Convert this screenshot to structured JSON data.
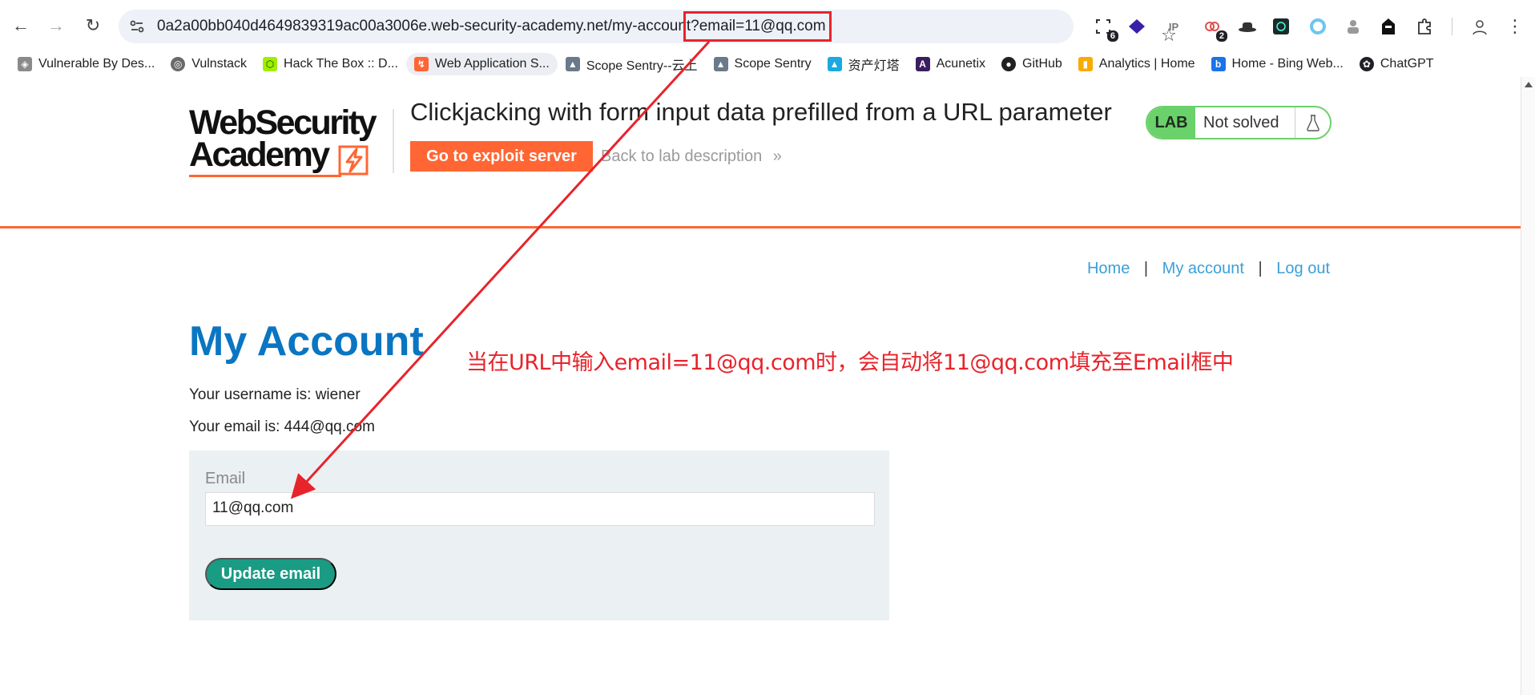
{
  "browser": {
    "url": "0a2a00bb040d4649839319ac00a3006e.web-security-academy.net/my-account?email=11@qq.com",
    "extensions": [
      {
        "name": "screenshot-ext",
        "badge": "6"
      },
      {
        "name": "stack-ext",
        "badge": ""
      },
      {
        "name": "ip-ext",
        "badge": ""
      },
      {
        "name": "link-ext",
        "badge": "2"
      },
      {
        "name": "hat-ext",
        "badge": ""
      },
      {
        "name": "terminal-ext",
        "badge": ""
      },
      {
        "name": "circle-ext",
        "badge": ""
      },
      {
        "name": "spy-ext",
        "badge": ""
      },
      {
        "name": "hacker-ext",
        "badge": ""
      }
    ]
  },
  "bookmarks": [
    {
      "label": "Vulnerable By Des...",
      "icon": "cube-icon",
      "color": "#8a8a8a"
    },
    {
      "label": "Vulnstack",
      "icon": "globe-icon",
      "color": "#6a6a6a"
    },
    {
      "label": "Hack The Box :: D...",
      "icon": "htb-icon",
      "color": "#9fef00"
    },
    {
      "label": "Web Application S...",
      "icon": "portswigger-icon",
      "color": "#ff6633"
    },
    {
      "label": "Scope Sentry--云上",
      "icon": "sentry-icon",
      "color": "#6a7a8a"
    },
    {
      "label": "Scope Sentry",
      "icon": "sentry-icon",
      "color": "#6a7a8a"
    },
    {
      "label": "资产灯塔",
      "icon": "lighthouse-icon",
      "color": "#1aa9e0"
    },
    {
      "label": "Acunetix",
      "icon": "acunetix-icon",
      "color": "#3a1f5f"
    },
    {
      "label": "GitHub",
      "icon": "github-icon",
      "color": "#202124"
    },
    {
      "label": "Analytics | Home",
      "icon": "analytics-icon",
      "color": "#f9ab00"
    },
    {
      "label": "Home - Bing Web...",
      "icon": "bing-icon",
      "color": "#1a73e8"
    },
    {
      "label": "ChatGPT",
      "icon": "chatgpt-icon",
      "color": "#202124"
    }
  ],
  "header": {
    "logo_line1": "WebSecurity",
    "logo_line2": "Academy",
    "lab_title": "Clickjacking with form input data prefilled from a URL parameter",
    "exploit_button": "Go to exploit server",
    "back_link": "Back to lab description",
    "back_chevron": "»",
    "lab_tag": "LAB",
    "lab_status": "Not solved"
  },
  "nav": {
    "home": "Home",
    "my_account": "My account",
    "log_out": "Log out",
    "separator": "|"
  },
  "account": {
    "title": "My Account",
    "username_line": "Your username is: wiener",
    "email_line": "Your email is: 444@qq.com",
    "email_label": "Email",
    "email_value": "11@qq.com",
    "update_button": "Update email"
  },
  "annotation": {
    "text": "当在URL中输入email=11@qq.com时，会自动将11@qq.com填充至Email框中",
    "color": "#e8232b"
  },
  "colors": {
    "accent_orange": "#ff6633",
    "link_blue": "#3a9fd8",
    "title_blue": "#0a75c2",
    "button_teal": "#1a9b84",
    "lab_green": "#6bd16b"
  }
}
